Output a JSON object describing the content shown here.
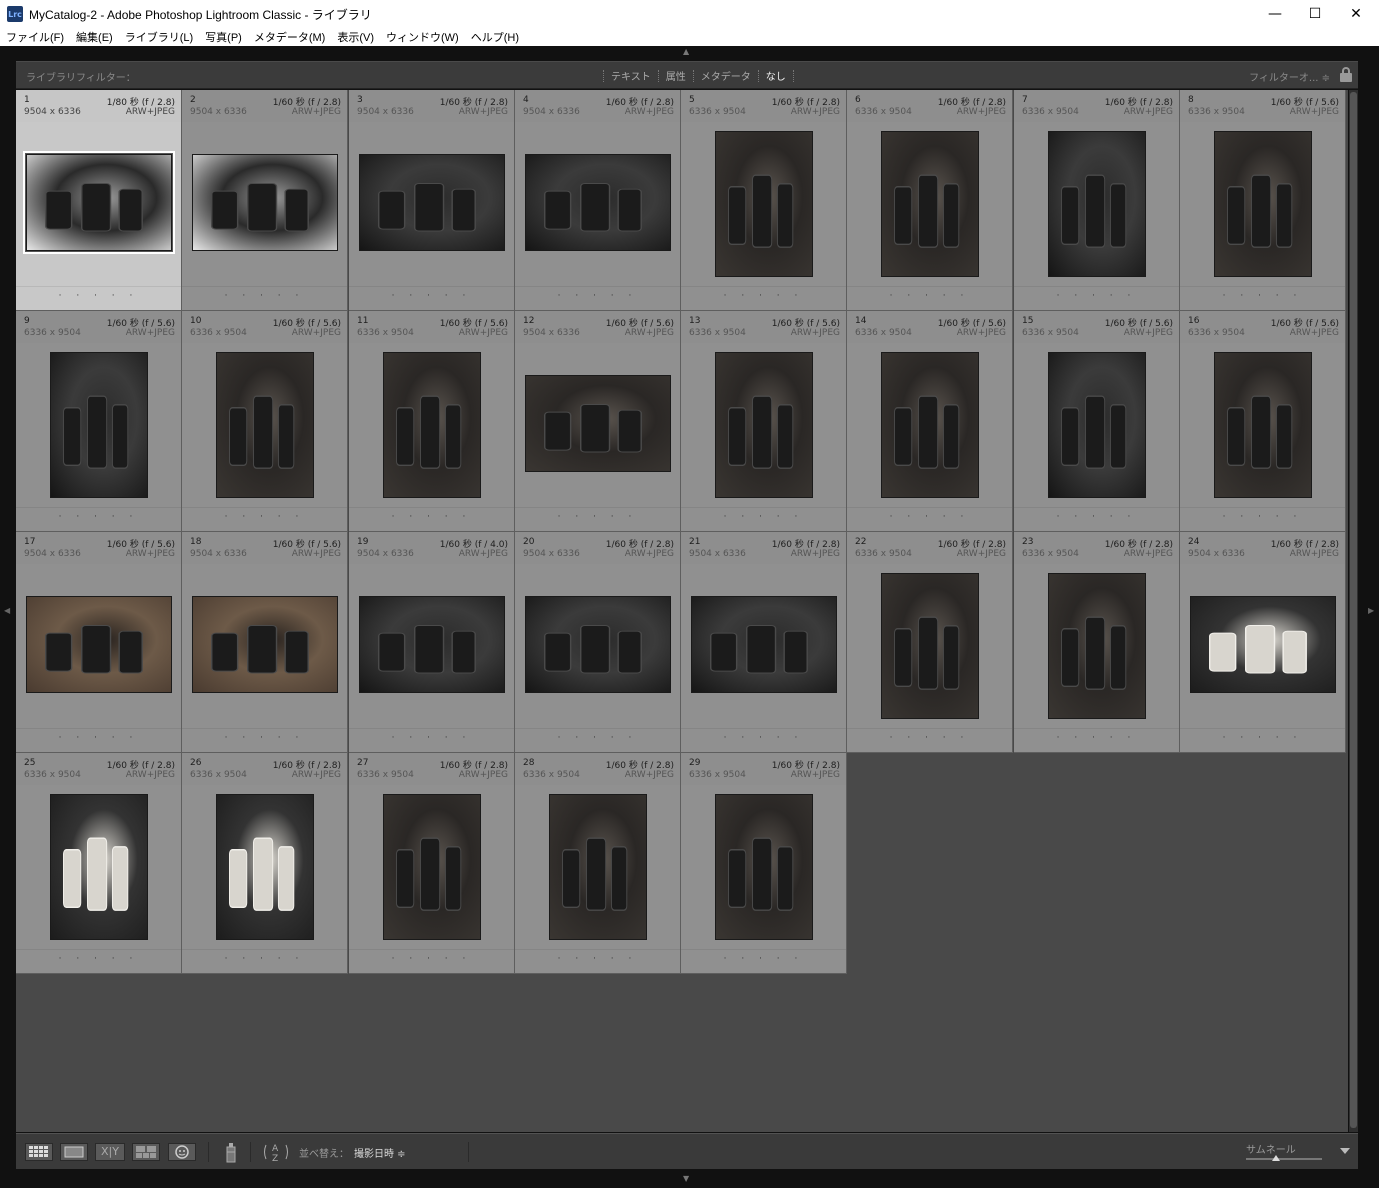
{
  "window": {
    "title": "MyCatalog-2 - Adobe Photoshop Lightroom Classic - ライブラリ",
    "app_icon": "Lrc"
  },
  "menu": [
    "ファイル(F)",
    "編集(E)",
    "ライブラリ(L)",
    "写真(P)",
    "メタデータ(M)",
    "表示(V)",
    "ウィンドウ(W)",
    "ヘルプ(H)"
  ],
  "filter_bar": {
    "label": "ライブラリフィルター：",
    "tabs": [
      "テキスト",
      "属性",
      "メタデータ",
      "なし"
    ],
    "active_tab": "なし",
    "preset": "フィルターオ... ≑"
  },
  "photos": [
    {
      "num": "1",
      "exposure": "1/80 秒 (f / 2.8)",
      "dims": "9504 x 6336",
      "format": "ARW+JPEG",
      "orient": "landscape",
      "tone": "light",
      "selected": true
    },
    {
      "num": "2",
      "exposure": "1/60 秒 (f / 2.8)",
      "dims": "9504 x 6336",
      "format": "ARW+JPEG",
      "orient": "landscape",
      "tone": "light"
    },
    {
      "num": "3",
      "exposure": "1/60 秒 (f / 2.8)",
      "dims": "9504 x 6336",
      "format": "ARW+JPEG",
      "orient": "landscape",
      "tone": "dark"
    },
    {
      "num": "4",
      "exposure": "1/60 秒 (f / 2.8)",
      "dims": "9504 x 6336",
      "format": "ARW+JPEG",
      "orient": "landscape",
      "tone": "dark"
    },
    {
      "num": "5",
      "exposure": "1/60 秒 (f / 2.8)",
      "dims": "6336 x 9504",
      "format": "ARW+JPEG",
      "orient": "portrait",
      "tone": "mid"
    },
    {
      "num": "6",
      "exposure": "1/60 秒 (f / 2.8)",
      "dims": "6336 x 9504",
      "format": "ARW+JPEG",
      "orient": "portrait",
      "tone": "mid"
    },
    {
      "num": "7",
      "exposure": "1/60 秒 (f / 2.8)",
      "dims": "6336 x 9504",
      "format": "ARW+JPEG",
      "orient": "portrait",
      "tone": "dark"
    },
    {
      "num": "8",
      "exposure": "1/60 秒 (f / 5.6)",
      "dims": "6336 x 9504",
      "format": "ARW+JPEG",
      "orient": "portrait",
      "tone": "mid"
    },
    {
      "num": "9",
      "exposure": "1/60 秒 (f / 5.6)",
      "dims": "6336 x 9504",
      "format": "ARW+JPEG",
      "orient": "portrait",
      "tone": "dark"
    },
    {
      "num": "10",
      "exposure": "1/60 秒 (f / 5.6)",
      "dims": "6336 x 9504",
      "format": "ARW+JPEG",
      "orient": "portrait",
      "tone": "mid"
    },
    {
      "num": "11",
      "exposure": "1/60 秒 (f / 5.6)",
      "dims": "6336 x 9504",
      "format": "ARW+JPEG",
      "orient": "portrait",
      "tone": "mid"
    },
    {
      "num": "12",
      "exposure": "1/60 秒 (f / 5.6)",
      "dims": "9504 x 6336",
      "format": "ARW+JPEG",
      "orient": "landscape",
      "tone": "mid"
    },
    {
      "num": "13",
      "exposure": "1/60 秒 (f / 5.6)",
      "dims": "6336 x 9504",
      "format": "ARW+JPEG",
      "orient": "portrait",
      "tone": "mid"
    },
    {
      "num": "14",
      "exposure": "1/60 秒 (f / 5.6)",
      "dims": "6336 x 9504",
      "format": "ARW+JPEG",
      "orient": "portrait",
      "tone": "mid"
    },
    {
      "num": "15",
      "exposure": "1/60 秒 (f / 5.6)",
      "dims": "6336 x 9504",
      "format": "ARW+JPEG",
      "orient": "portrait",
      "tone": "dark"
    },
    {
      "num": "16",
      "exposure": "1/60 秒 (f / 5.6)",
      "dims": "6336 x 9504",
      "format": "ARW+JPEG",
      "orient": "portrait",
      "tone": "mid"
    },
    {
      "num": "17",
      "exposure": "1/60 秒 (f / 5.6)",
      "dims": "9504 x 6336",
      "format": "ARW+JPEG",
      "orient": "landscape",
      "tone": "warm"
    },
    {
      "num": "18",
      "exposure": "1/60 秒 (f / 5.6)",
      "dims": "9504 x 6336",
      "format": "ARW+JPEG",
      "orient": "landscape",
      "tone": "warm"
    },
    {
      "num": "19",
      "exposure": "1/60 秒 (f / 4.0)",
      "dims": "9504 x 6336",
      "format": "ARW+JPEG",
      "orient": "landscape",
      "tone": "dark"
    },
    {
      "num": "20",
      "exposure": "1/60 秒 (f / 2.8)",
      "dims": "9504 x 6336",
      "format": "ARW+JPEG",
      "orient": "landscape",
      "tone": "dark"
    },
    {
      "num": "21",
      "exposure": "1/60 秒 (f / 2.8)",
      "dims": "9504 x 6336",
      "format": "ARW+JPEG",
      "orient": "landscape",
      "tone": "dark"
    },
    {
      "num": "22",
      "exposure": "1/60 秒 (f / 2.8)",
      "dims": "6336 x 9504",
      "format": "ARW+JPEG",
      "orient": "portrait",
      "tone": "mid"
    },
    {
      "num": "23",
      "exposure": "1/60 秒 (f / 2.8)",
      "dims": "6336 x 9504",
      "format": "ARW+JPEG",
      "orient": "portrait",
      "tone": "mid"
    },
    {
      "num": "24",
      "exposure": "1/60 秒 (f / 2.8)",
      "dims": "9504 x 6336",
      "format": "ARW+JPEG",
      "orient": "landscape",
      "tone": "white"
    },
    {
      "num": "25",
      "exposure": "1/60 秒 (f / 2.8)",
      "dims": "6336 x 9504",
      "format": "ARW+JPEG",
      "orient": "portrait",
      "tone": "white"
    },
    {
      "num": "26",
      "exposure": "1/60 秒 (f / 2.8)",
      "dims": "6336 x 9504",
      "format": "ARW+JPEG",
      "orient": "portrait",
      "tone": "white"
    },
    {
      "num": "27",
      "exposure": "1/60 秒 (f / 2.8)",
      "dims": "6336 x 9504",
      "format": "ARW+JPEG",
      "orient": "portrait",
      "tone": "mid"
    },
    {
      "num": "28",
      "exposure": "1/60 秒 (f / 2.8)",
      "dims": "6336 x 9504",
      "format": "ARW+JPEG",
      "orient": "portrait",
      "tone": "mid"
    },
    {
      "num": "29",
      "exposure": "1/60 秒 (f / 2.8)",
      "dims": "6336 x 9504",
      "format": "ARW+JPEG",
      "orient": "portrait",
      "tone": "mid"
    }
  ],
  "rating_dots": "· · · · ·",
  "toolbar": {
    "view_buttons": [
      "grid-view-icon",
      "loupe-view-icon",
      "compare-view-icon",
      "survey-view-icon",
      "people-view-icon"
    ],
    "compare_label": "X|Y",
    "sort_label": "並べ替え：",
    "sort_value": "撮影日時 ≑",
    "thumbnail_label": "サムネール",
    "thumbnail_size_fraction": 0.4
  },
  "colors": {
    "selected_cell": "#c8c8c8",
    "cell": "#909090",
    "grid_bg": "#494949"
  }
}
